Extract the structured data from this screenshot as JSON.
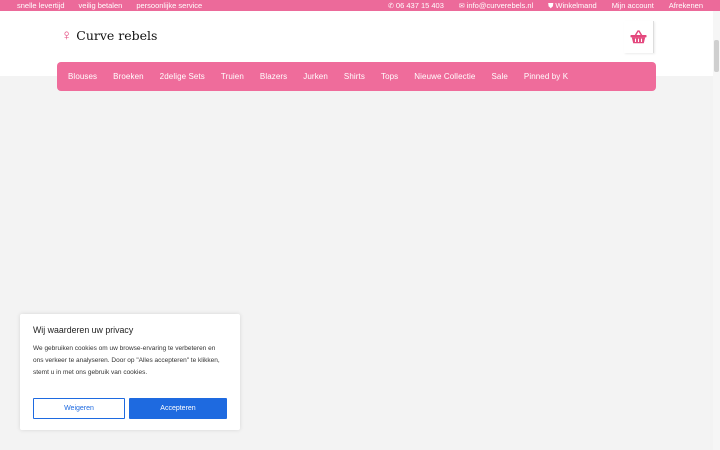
{
  "topbar": {
    "usps": [
      "snelle levertijd",
      "veilig betalen",
      "persoonlijke service"
    ],
    "phone": "06 437 15 403",
    "email": "info@curverebels.nl",
    "cart_link": "Winkelmand",
    "account_link": "Mijn account",
    "checkout_link": "Afrekenen"
  },
  "header": {
    "logo_text": "Curve rebels"
  },
  "nav": {
    "items": [
      "Blouses",
      "Broeken",
      "2delige Sets",
      "Truien",
      "Blazers",
      "Jurken",
      "Shirts",
      "Tops",
      "Nieuwe Collectie",
      "Sale",
      "Pinned by K"
    ]
  },
  "cookie": {
    "title": "Wij waarderen uw privacy",
    "text": "We gebruiken cookies om uw browse-ervaring te verbeteren en ons verkeer te analyseren. Door op \"Alles accepteren\" te klikken, stemt u in met ons gebruik van cookies.",
    "deny_label": "Weigeren",
    "accept_label": "Accepteren"
  },
  "colors": {
    "brand_pink": "#ef6c9b",
    "accent_blue": "#1e6ae0",
    "background": "#f3f3f3"
  },
  "icons": {
    "phone": "phone-icon",
    "email": "envelope-icon",
    "cart": "shopping-basket-icon",
    "logo": "venus-icon"
  }
}
